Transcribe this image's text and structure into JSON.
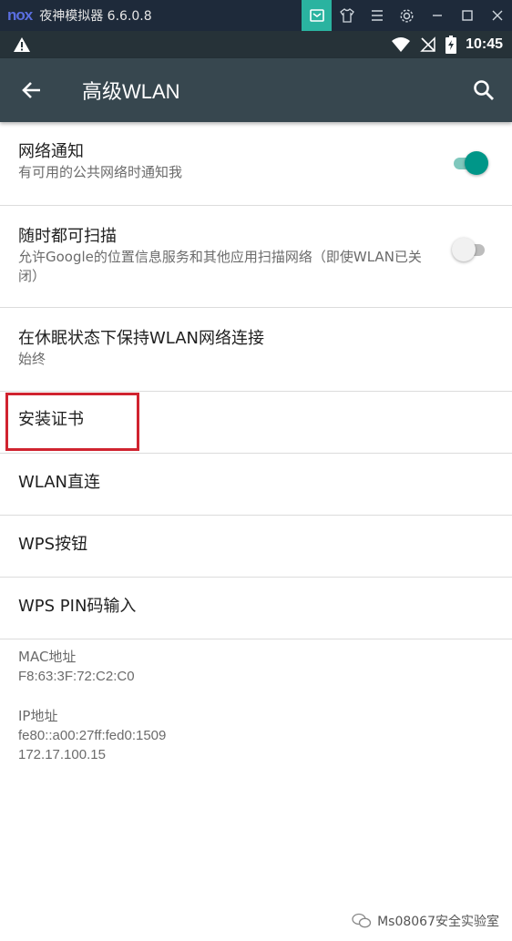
{
  "emulator": {
    "logo": "nox",
    "title": "夜神模拟器 6.6.0.8",
    "controls": [
      "gift-icon",
      "shirt-icon",
      "menu-icon",
      "settings-icon",
      "minimize-icon",
      "maximize-icon",
      "close-icon"
    ]
  },
  "status_bar": {
    "time": "10:45"
  },
  "app_bar": {
    "title": "高级WLAN"
  },
  "settings": {
    "network_notify": {
      "title": "网络通知",
      "subtitle": "有可用的公共网络时通知我",
      "enabled": true
    },
    "always_scan": {
      "title": "随时都可扫描",
      "subtitle": "允许Google的位置信息服务和其他应用扫描网络（即使WLAN已关闭）",
      "enabled": false
    },
    "keep_wifi_sleep": {
      "title": "在休眠状态下保持WLAN网络连接",
      "subtitle": "始终"
    },
    "install_cert": {
      "title": "安装证书"
    },
    "wlan_direct": {
      "title": "WLAN直连"
    },
    "wps_button": {
      "title": "WPS按钮"
    },
    "wps_pin": {
      "title": "WPS PIN码输入"
    }
  },
  "info": {
    "mac_label": "MAC地址",
    "mac_value": "F8:63:3F:72:C2:C0",
    "ip_label": "IP地址",
    "ip_v6": "fe80::a00:27ff:fed0:1509",
    "ip_v4": "172.17.100.15"
  },
  "watermark": {
    "text": "Ms08067安全实验室"
  },
  "colors": {
    "accent": "#009688",
    "app_bar": "#37474f",
    "status_bar": "#263238",
    "highlight": "#d0232f"
  }
}
